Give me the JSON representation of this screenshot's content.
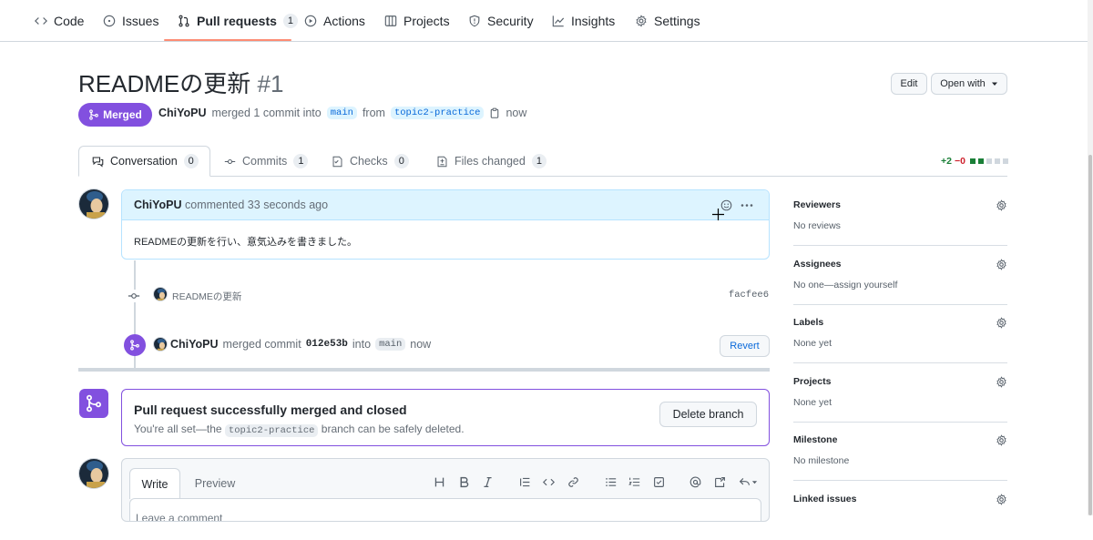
{
  "repo_nav": {
    "items": [
      {
        "label": "Code",
        "icon": "code-icon"
      },
      {
        "label": "Issues",
        "icon": "issue-opened-icon"
      },
      {
        "label": "Pull requests",
        "icon": "git-pull-request-icon",
        "count": "1",
        "active": true
      },
      {
        "label": "Actions",
        "icon": "play-icon"
      },
      {
        "label": "Projects",
        "icon": "table-icon"
      },
      {
        "label": "Security",
        "icon": "shield-icon"
      },
      {
        "label": "Insights",
        "icon": "graph-icon"
      },
      {
        "label": "Settings",
        "icon": "gear-icon"
      }
    ]
  },
  "pr": {
    "title": "READMEの更新",
    "number": "#1",
    "state": "Merged",
    "author": "ChiYoPU",
    "merged_text": "merged 1 commit into",
    "base_branch": "main",
    "from_text": "from",
    "head_branch": "topic2-practice",
    "time": "now"
  },
  "header_buttons": {
    "edit": "Edit",
    "open_with": "Open with"
  },
  "tabs": [
    {
      "label": "Conversation",
      "count": "0",
      "icon": "comment-discussion-icon"
    },
    {
      "label": "Commits",
      "count": "1",
      "icon": "git-commit-icon"
    },
    {
      "label": "Checks",
      "count": "0",
      "icon": "checklist-icon"
    },
    {
      "label": "Files changed",
      "count": "1",
      "icon": "file-diff-icon"
    }
  ],
  "diffstat": {
    "additions": "+2",
    "deletions": "−0",
    "add_color": "#1a7f37",
    "neutral_color": "#d0d7de"
  },
  "comment": {
    "author": "ChiYoPU",
    "meta": "commented 33 seconds ago",
    "body": "READMEの更新を行い、意気込みを書きました。"
  },
  "commit_event": {
    "message": "READMEの更新",
    "sha": "facfee6"
  },
  "merge_event": {
    "actor": "ChiYoPU",
    "text1": "merged commit",
    "sha": "012e53b",
    "text2": "into",
    "branch": "main",
    "time": "now",
    "revert": "Revert"
  },
  "merged_box": {
    "title": "Pull request successfully merged and closed",
    "pre": "You're all set—the",
    "branch": "topic2-practice",
    "post": "branch can be safely deleted.",
    "delete_button": "Delete branch",
    "accent": "#8250df"
  },
  "composer": {
    "write_tab": "Write",
    "preview_tab": "Preview",
    "placeholder": "Leave a comment"
  },
  "sidebar": [
    {
      "heading": "Reviewers",
      "value": "No reviews"
    },
    {
      "heading": "Assignees",
      "value": "No one—assign yourself"
    },
    {
      "heading": "Labels",
      "value": "None yet"
    },
    {
      "heading": "Projects",
      "value": "None yet"
    },
    {
      "heading": "Milestone",
      "value": "No milestone"
    },
    {
      "heading": "Linked issues",
      "value": ""
    }
  ]
}
